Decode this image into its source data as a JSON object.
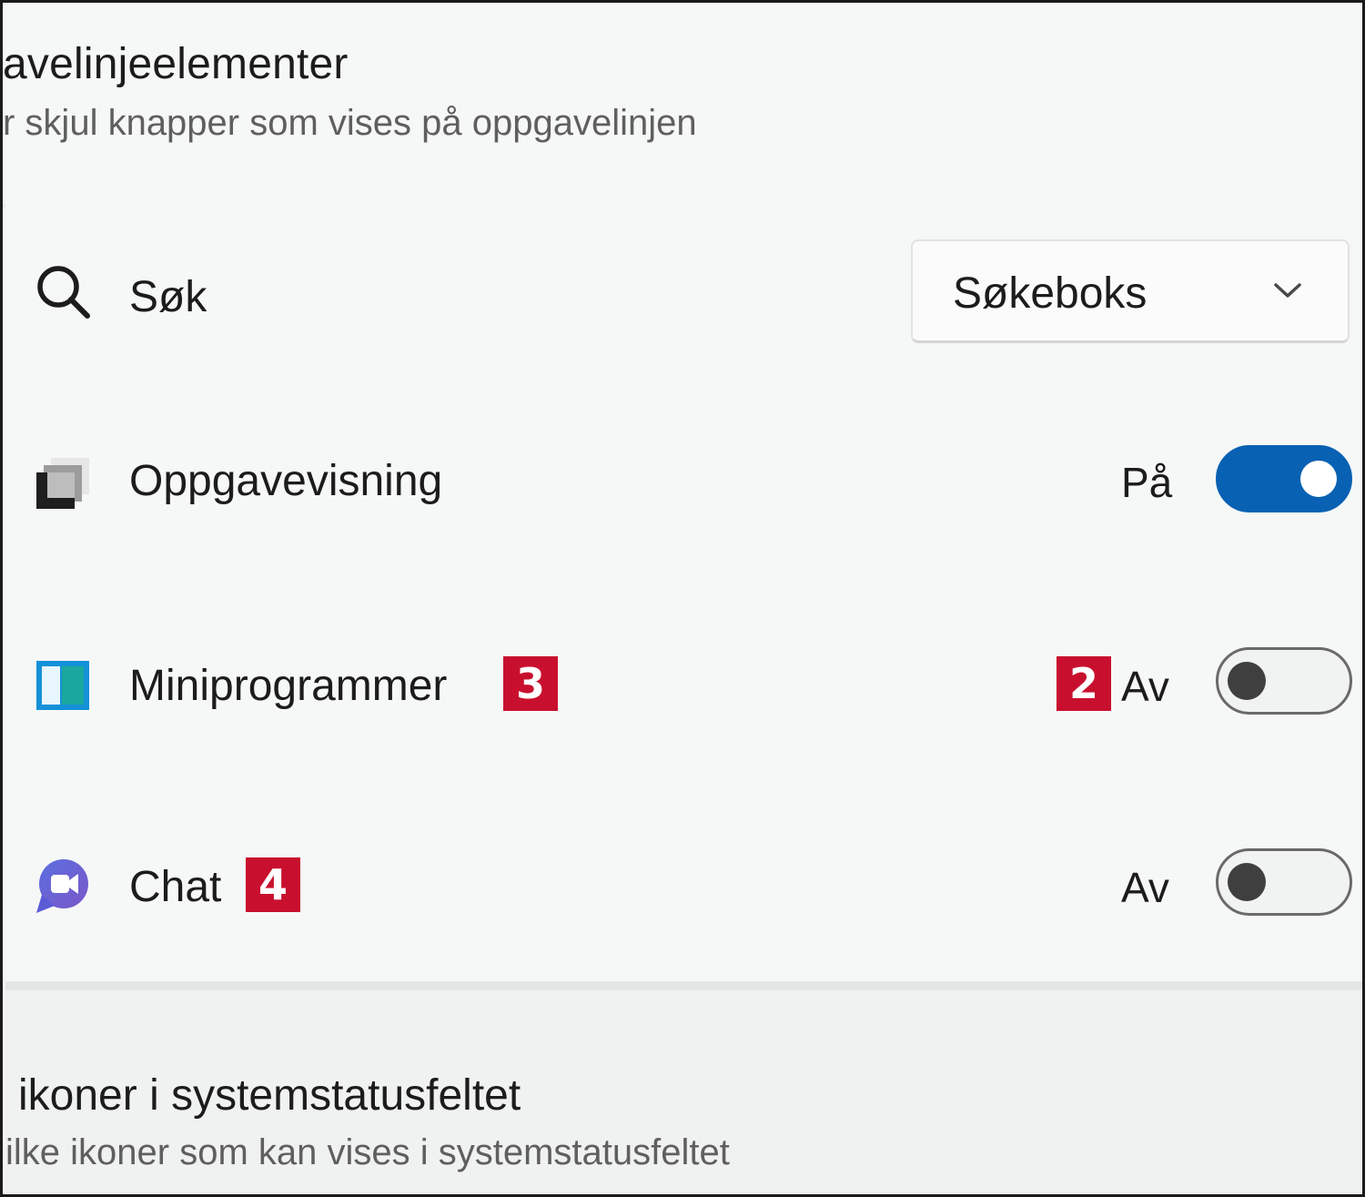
{
  "header": {
    "title": "avelinjeelementer",
    "subtitle": "r skjul knapper som vises på oppgavelinjen"
  },
  "rows": [
    {
      "label": "Søk",
      "icon": "search-icon",
      "control": "dropdown",
      "dropdown_value": "Søkeboks",
      "dropdown_icon": "chevron-down-icon"
    },
    {
      "label": "Oppgavevisning",
      "icon": "task-view-icon",
      "control": "toggle",
      "state_text": "På",
      "toggle_on": true
    },
    {
      "label": "Miniprogrammer",
      "icon": "widgets-icon",
      "label_badge": "3",
      "control": "toggle",
      "state_badge": "2",
      "state_text": "Av",
      "toggle_on": false
    },
    {
      "label": "Chat",
      "icon": "chat-icon",
      "label_badge": "4",
      "control": "toggle",
      "state_text": "Av",
      "toggle_on": false
    }
  ],
  "footer": {
    "title": "ikoner i systemstatusfeltet",
    "subtitle": "ilke ikoner som kan vises i systemstatusfeltet"
  },
  "colors": {
    "toggle_on": "#0861b3",
    "badge": "#c8102e",
    "background": "#f6f8f7"
  }
}
